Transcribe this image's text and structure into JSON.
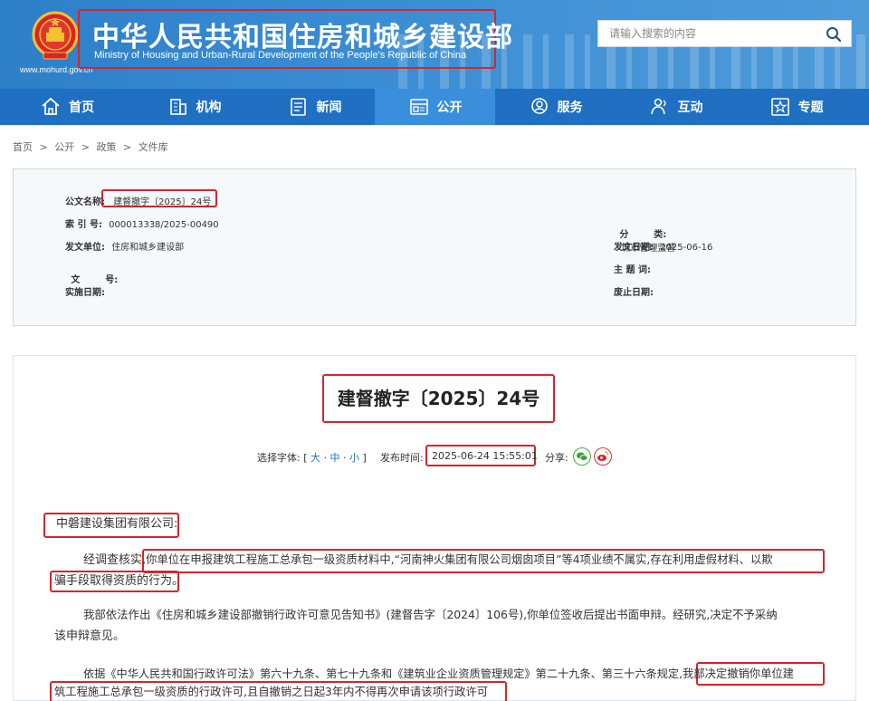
{
  "header": {
    "title_cn": "中华人民共和国住房和城乡建设部",
    "title_en": "Ministry of Housing and Urban-Rural Development of the People's Republic of China",
    "site_url": "www.mohurd.gov.cn",
    "search_placeholder": "请输入搜索的内容"
  },
  "nav": {
    "items": [
      {
        "label": "首页",
        "icon": "home-icon"
      },
      {
        "label": "机构",
        "icon": "building-icon"
      },
      {
        "label": "新闻",
        "icon": "news-icon"
      },
      {
        "label": "公开",
        "icon": "disclosure-icon",
        "active": true
      },
      {
        "label": "服务",
        "icon": "service-icon"
      },
      {
        "label": "互动",
        "icon": "interact-icon"
      },
      {
        "label": "专题",
        "icon": "topic-icon"
      }
    ]
  },
  "breadcrumb": [
    "首页",
    ">",
    "公开",
    ">",
    "政策",
    ">",
    "文件库"
  ],
  "info": {
    "doc_name_label": "公文名称:",
    "doc_name": "建督撤字〔2025〕24号",
    "index_label": "索 引 号:",
    "index_value": "000013338/2025-00490",
    "issuer_label": "发文单位:",
    "issuer_value": "住房和城乡建设部",
    "docno_label": "文        号:",
    "docno_value": "",
    "effective_label": "实施日期:",
    "effective_value": "",
    "category_label": "分        类:",
    "category_value": "城市管理监督",
    "issue_date_label": "发文日期:",
    "issue_date_value": "2025-06-16",
    "subject_label": "主 题 词:",
    "subject_value": "",
    "expire_label": "废止日期:",
    "expire_value": ""
  },
  "article": {
    "title": "建督撤字〔2025〕24号",
    "font_label": "选择字体:",
    "font_open": "[",
    "font_large": "大",
    "font_dot1": "·",
    "font_medium": "中",
    "font_dot2": "·",
    "font_small": "小",
    "font_close": "]",
    "pubtime_label": "发布时间:",
    "pubtime": "2025-06-24 15:55:01",
    "share_label": "分享:",
    "addressee": "中磐建设集团有限公司:",
    "p1_a": "经调查核实,",
    "p1_b": "你单位在申报建筑工程施工总承包一级资质材料中,“河南神火集团有限公司烟囱项目”等4项业绩不属实,存在利用虚假材料、以欺",
    "p1_c": "骗手段取得资质的行为。",
    "p2_a": "我部依法作出《住房和城乡建设部撤销行政许可意见告知书》(建督告字〔2024〕106号),你单位签收后提出书面申辩。经研究,决定不予采纳",
    "p2_b": "该申辩意见。",
    "p3_a": "依据《中华人民共和国行政许可法》第六十九条、第七十九条和《建筑业企业资质管理规定》第二十九条、第三十六条规定,",
    "p3_b": "我部决定撤销你单位建",
    "p3_c": "筑工程施工总承包一级资质的行政许可,且自撤销之日起3年内不得再次申请该项行政许可"
  },
  "colors": {
    "header_blue": "#2d7fc8",
    "nav_blue": "#1f6fc2",
    "nav_active": "#3a8fdc",
    "highlight_red": "#d8242b"
  }
}
